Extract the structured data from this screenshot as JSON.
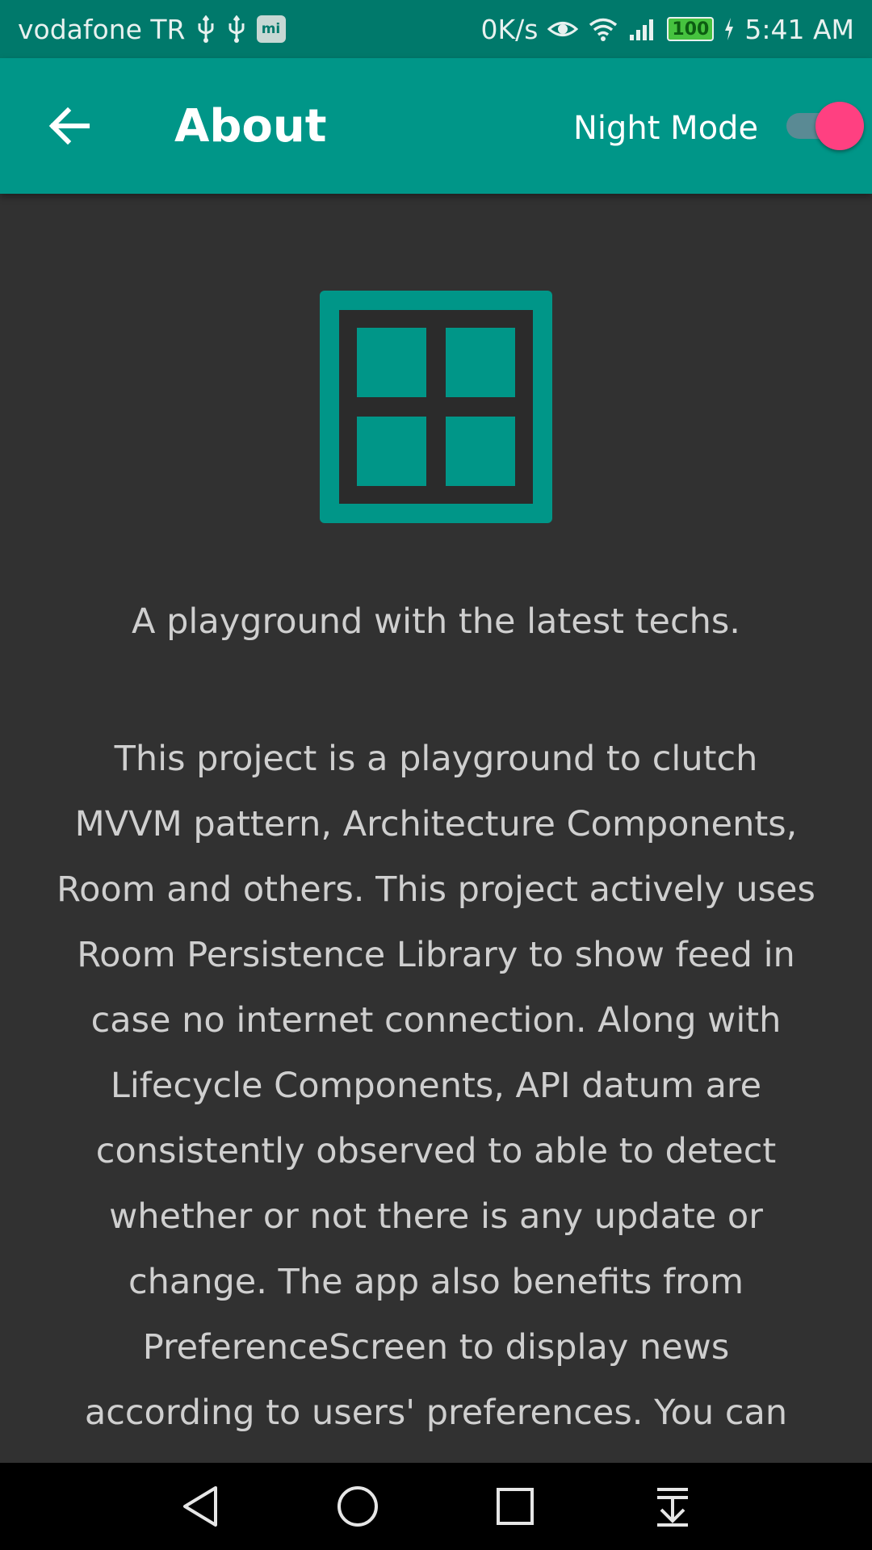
{
  "status_bar": {
    "carrier": "vodafone TR",
    "net_speed": "0K/s",
    "battery": "100",
    "time": "5:41 AM",
    "icons": [
      "usb-icon",
      "usb-icon",
      "mi-icon",
      "eye-icon",
      "wifi-icon",
      "signal-icon",
      "battery-icon",
      "charging-icon"
    ],
    "mi_text": "mi"
  },
  "app_bar": {
    "back_icon": "arrow-left-icon",
    "title": "About",
    "night_mode_label": "Night Mode",
    "night_mode_on": true
  },
  "content": {
    "logo_icon": "grid-window-icon",
    "tagline": "A playground with the latest techs.",
    "description": "This project is a playground to clutch MVVM pattern, Architecture Components, Room and others. This project actively uses Room Persistence Library to show feed in case no internet connection. Along with Lifecycle Components, API datum are consistently observed to able to detect whether or not there is any update or change. The app also benefits from PreferenceScreen to display news according to users' preferences. You can choose country, category, source or language as for different lists."
  },
  "nav_bar": {
    "icons": [
      "back-triangle-icon",
      "home-circle-icon",
      "recents-square-icon",
      "notification-pull-icon"
    ]
  },
  "colors": {
    "status_bar": "#00796b",
    "primary": "#009688",
    "accent": "#ff4081",
    "background": "#313131",
    "text": "#cfcfcf"
  }
}
